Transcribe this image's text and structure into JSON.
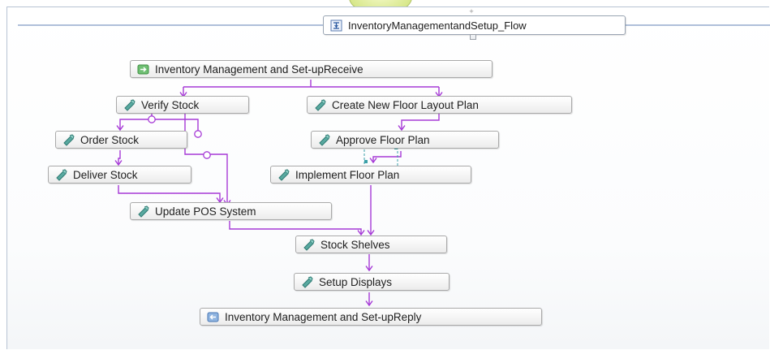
{
  "flow": {
    "title": "InventoryManagementandSetup_Flow",
    "icon": "flow-icon"
  },
  "nodes": {
    "receive": {
      "label": "Inventory Management and Set-upReceive",
      "icon": "receive-icon"
    },
    "verify_stock": {
      "label": "Verify Stock",
      "icon": "activity-icon"
    },
    "create_layout": {
      "label": "Create New Floor Layout Plan",
      "icon": "activity-icon"
    },
    "order_stock": {
      "label": "Order Stock",
      "icon": "activity-icon"
    },
    "approve_plan": {
      "label": "Approve Floor Plan",
      "icon": "activity-icon"
    },
    "deliver_stock": {
      "label": "Deliver Stock",
      "icon": "activity-icon"
    },
    "implement_plan": {
      "label": "Implement Floor Plan",
      "icon": "activity-icon"
    },
    "update_pos": {
      "label": "Update POS System",
      "icon": "activity-icon"
    },
    "stock_shelves": {
      "label": "Stock Shelves",
      "icon": "activity-icon"
    },
    "setup_displays": {
      "label": "Setup Displays",
      "icon": "activity-icon"
    },
    "reply": {
      "label": "Inventory Management and Set-upReply",
      "icon": "reply-icon"
    }
  },
  "colors": {
    "link": "#a63ad6",
    "frame_line": "#7f9bc4",
    "selection": "#3aa0a8"
  }
}
